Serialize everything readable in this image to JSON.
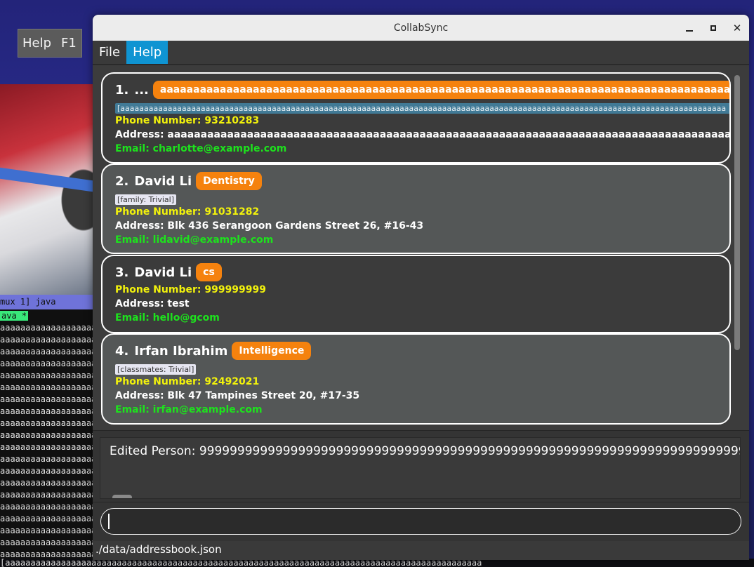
{
  "desktop": {
    "help_key": "Help",
    "help_shortcut": "F1",
    "terminal": {
      "status": "mux 1] java",
      "window": "ava *",
      "line": "aaaaaaaaaaaaaaaaaaaaaaaaaaaaaaaaaaaaaaaa",
      "bottom_line": "[aaaaaaaaaaaaaaaaaaaaaaaaaaaaaaaaaaaaaaaaaaaaaaaaaaaaaaaaaaaaaaaaaaaaaaaaaaaaaaaaaaaaaaaaaaaaaa"
    }
  },
  "window": {
    "title": "CollabSync",
    "controls": {
      "minimize": "minimize",
      "maximize": "maximize",
      "close": "✕"
    }
  },
  "menu": {
    "items": [
      {
        "label": "File",
        "active": false
      },
      {
        "label": "Help",
        "active": true
      }
    ]
  },
  "persons": [
    {
      "index": "1.",
      "name": "...",
      "tags": [
        "aaaaaaaaaaaaaaaaaaaaaaaaaaaaaaaaaaaaaaaaaaaaaaaaaaaaaaaaaaaaaaaaaaaaaaaaaaaaaaaaaaaaaaaaaaaaaaaaaaaaaa"
      ],
      "subtag": "[aaaaaaaaaaaaaaaaaaaaaaaaaaaaaaaaaaaaaaaaaaaaaaaaaaaaaaaaaaaaaaaaaaaaaaaaaaaaaaaaaaaaaaaaaaaaaaaaaaaaaaaaaaaaaaaaaaaaaaaaaaaaaaaa",
      "phone": "Phone Number: 93210283",
      "address": "Address: aaaaaaaaaaaaaaaaaaaaaaaaaaaaaaaaaaaaaaaaaaaaaaaaaaaaaaaaaaaaaaaaaaaaaaaaaaaaaaaaaaaaaaaaaaaaaaaaaaaaaaaaaa",
      "email": "Email: charlotte@example.com"
    },
    {
      "index": "2.",
      "name": "David Li",
      "tags": [
        "Dentistry"
      ],
      "subtag": "[family: Trivial]",
      "phone": "Phone Number: 91031282",
      "address": "Address: Blk 436 Serangoon Gardens Street 26, #16-43",
      "email": "Email: lidavid@example.com"
    },
    {
      "index": "3.",
      "name": "David Li",
      "tags": [
        "cs"
      ],
      "subtag": "",
      "phone": "Phone Number: 999999999",
      "address": "Address: test",
      "email": "Email: hello@gcom"
    },
    {
      "index": "4.",
      "name": "Irfan Ibrahim",
      "tags": [
        "Intelligence"
      ],
      "subtag": "[classmates: Trivial]",
      "phone": "Phone Number: 92492021",
      "address": "Address: Blk 47 Tampines Street 20, #17-35",
      "email": "Email: irfan@example.com"
    }
  ],
  "result": {
    "text": "Edited Person: 999999999999999999999999999999999999999999999999999999999999999999999999"
  },
  "command": {
    "value": ""
  },
  "status": {
    "path": "./data/addressbook.json"
  },
  "colors": {
    "accent": "#0f94d2",
    "tag": "#f5820e",
    "phone": "#f2f20c",
    "email": "#1de21d"
  }
}
